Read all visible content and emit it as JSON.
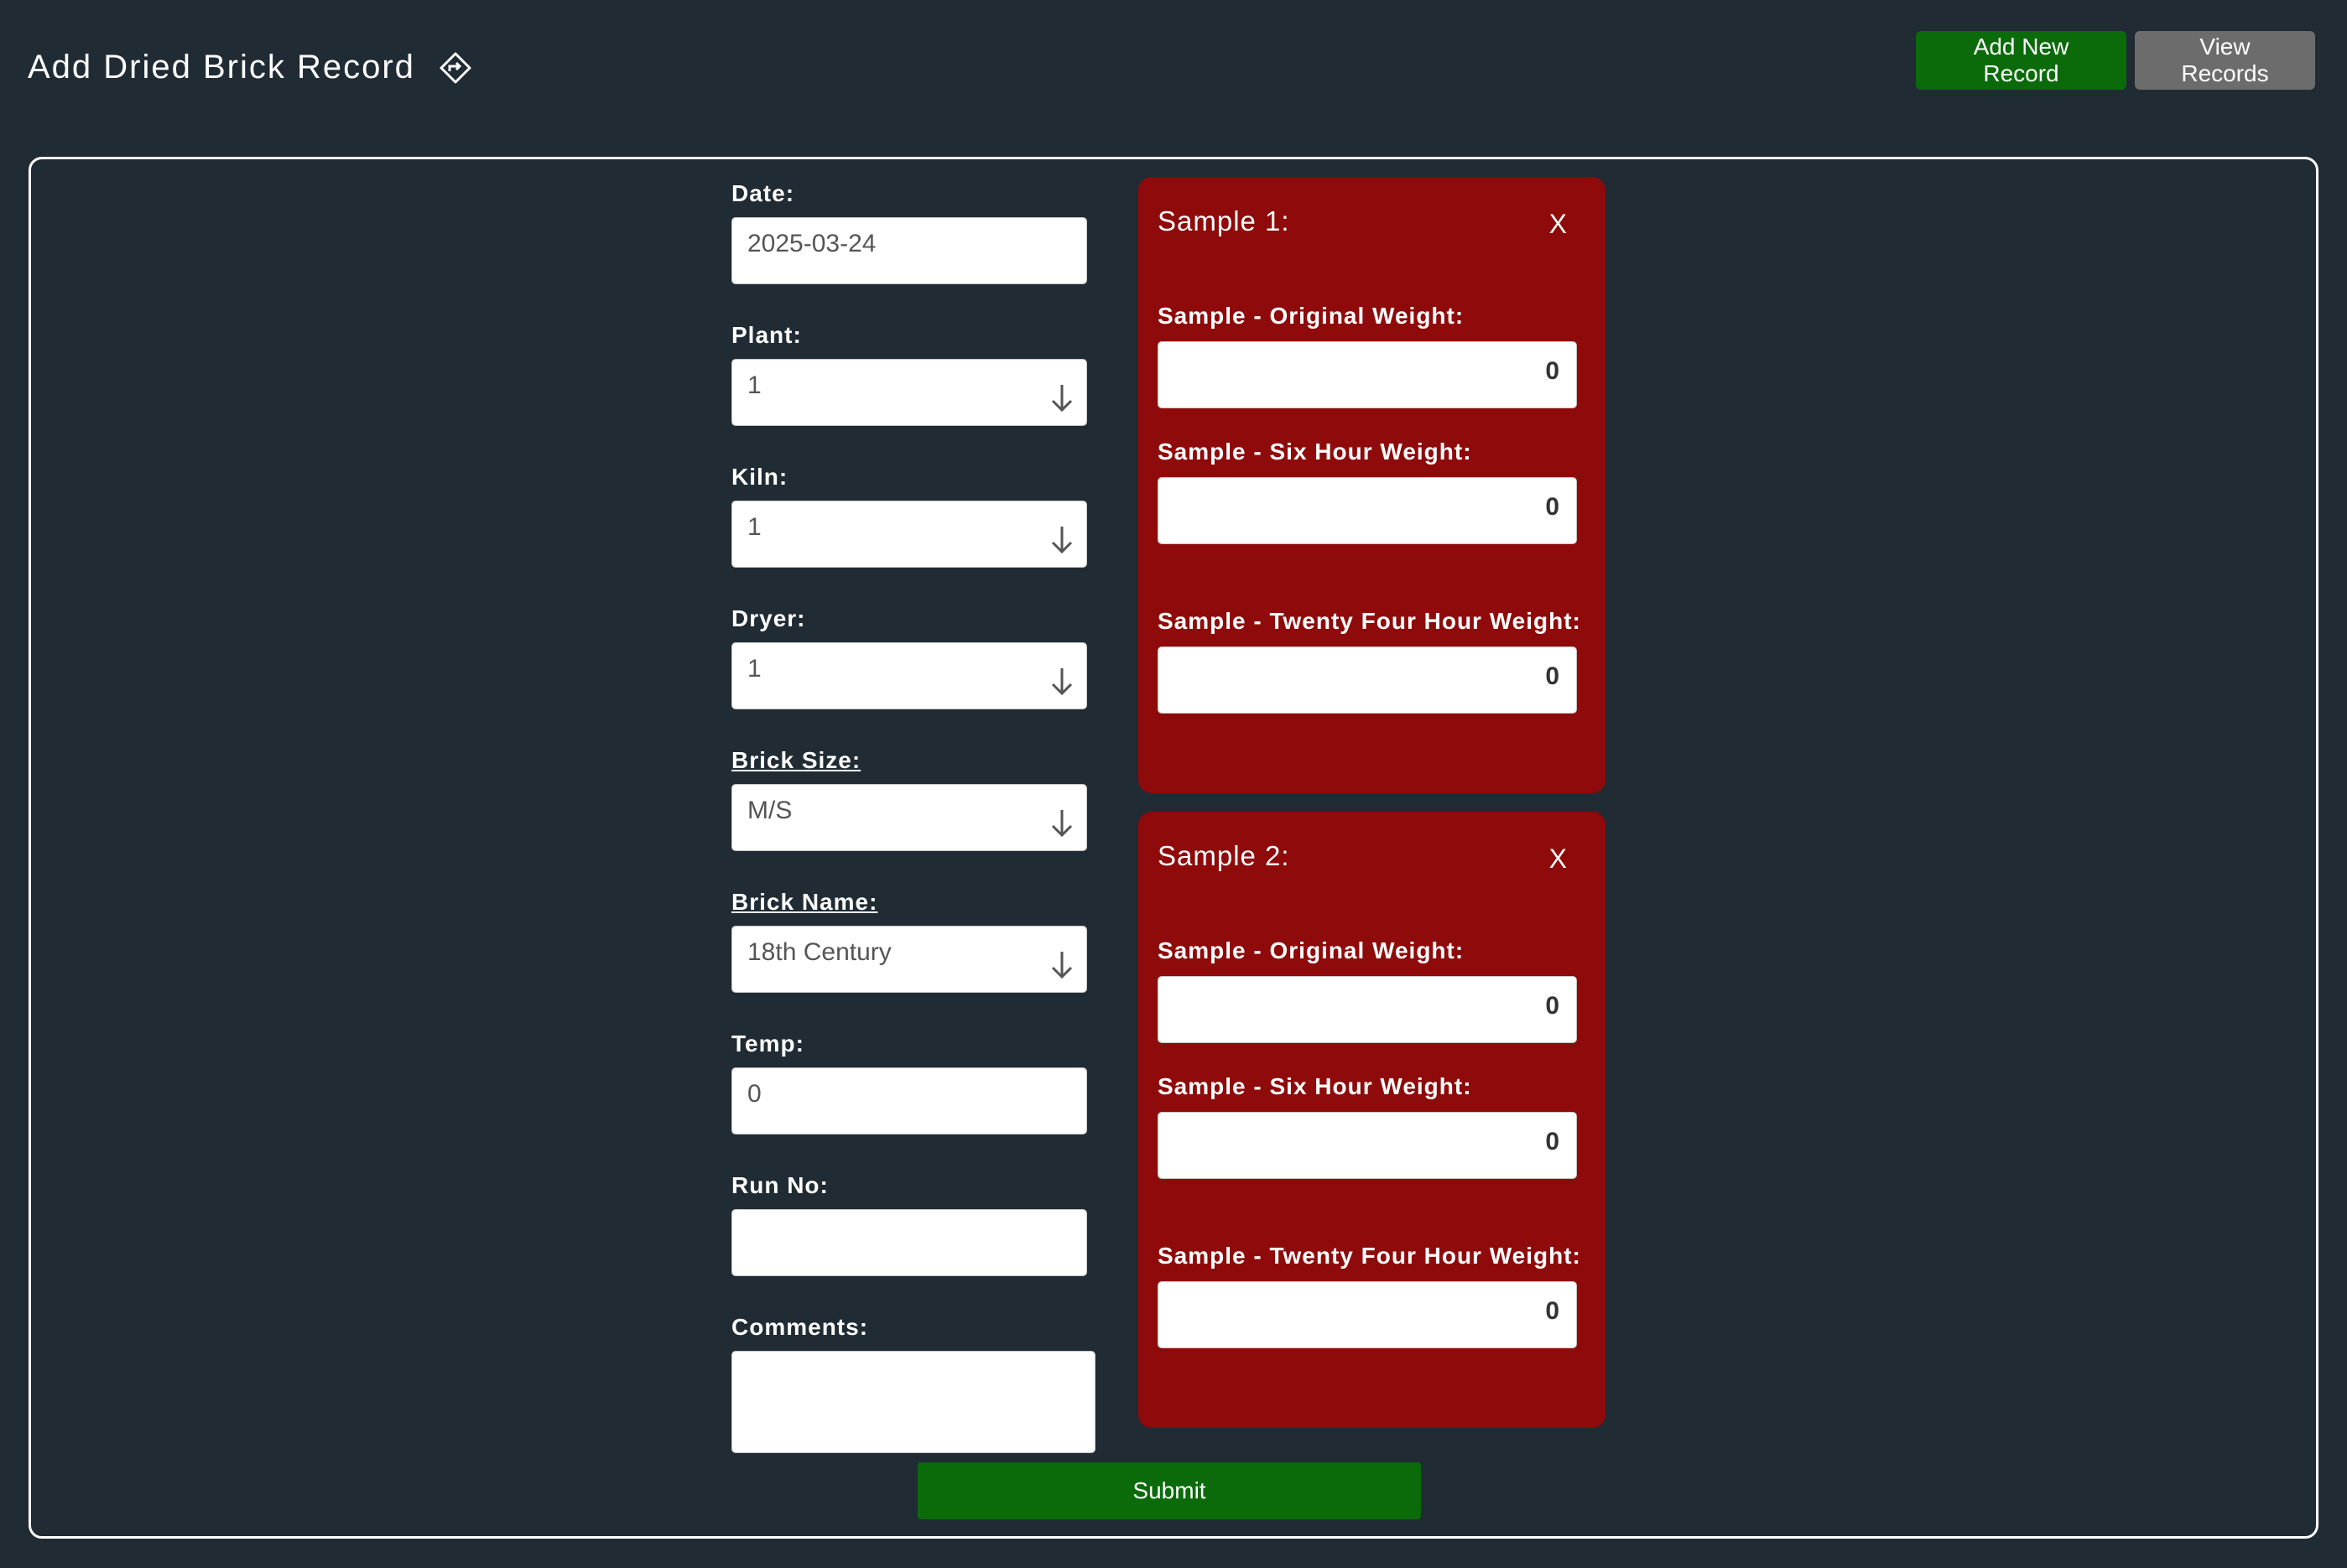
{
  "header": {
    "title": "Add Dried Brick Record",
    "title_icon": "diamond-arrow-icon",
    "add_new_label": "Add New Record",
    "view_records_label": "View Records"
  },
  "form": {
    "date": {
      "label": "Date:",
      "value": "2025-03-24"
    },
    "plant": {
      "label": "Plant:",
      "value": "1"
    },
    "kiln": {
      "label": "Kiln:",
      "value": "1"
    },
    "dryer": {
      "label": "Dryer:",
      "value": "1"
    },
    "brick_size": {
      "label": "Brick Size:",
      "value": "M/S"
    },
    "brick_name": {
      "label": "Brick Name:",
      "value": "18th Century"
    },
    "temp": {
      "label": "Temp:",
      "value": "0"
    },
    "run_no": {
      "label": "Run No:",
      "value": ""
    },
    "comments": {
      "label": "Comments:",
      "value": ""
    }
  },
  "samples": [
    {
      "title": "Sample 1:",
      "close": "X",
      "original_label": "Sample - Original Weight:",
      "original_value": "0",
      "six_hour_label": "Sample - Six Hour Weight:",
      "six_hour_value": "0",
      "twenty_four_label": "Sample - Twenty Four Hour Weight:",
      "twenty_four_value": "0"
    },
    {
      "title": "Sample 2:",
      "close": "X",
      "original_label": "Sample - Original Weight:",
      "original_value": "0",
      "six_hour_label": "Sample - Six Hour Weight:",
      "six_hour_value": "0",
      "twenty_four_label": "Sample - Twenty Four Hour Weight:",
      "twenty_four_value": "0"
    }
  ],
  "submit_label": "Submit",
  "colors": {
    "background": "#202b34",
    "sample_card": "#8f0a0a",
    "primary_green": "#0b6b0b",
    "secondary_gray": "#6c6c6c"
  }
}
